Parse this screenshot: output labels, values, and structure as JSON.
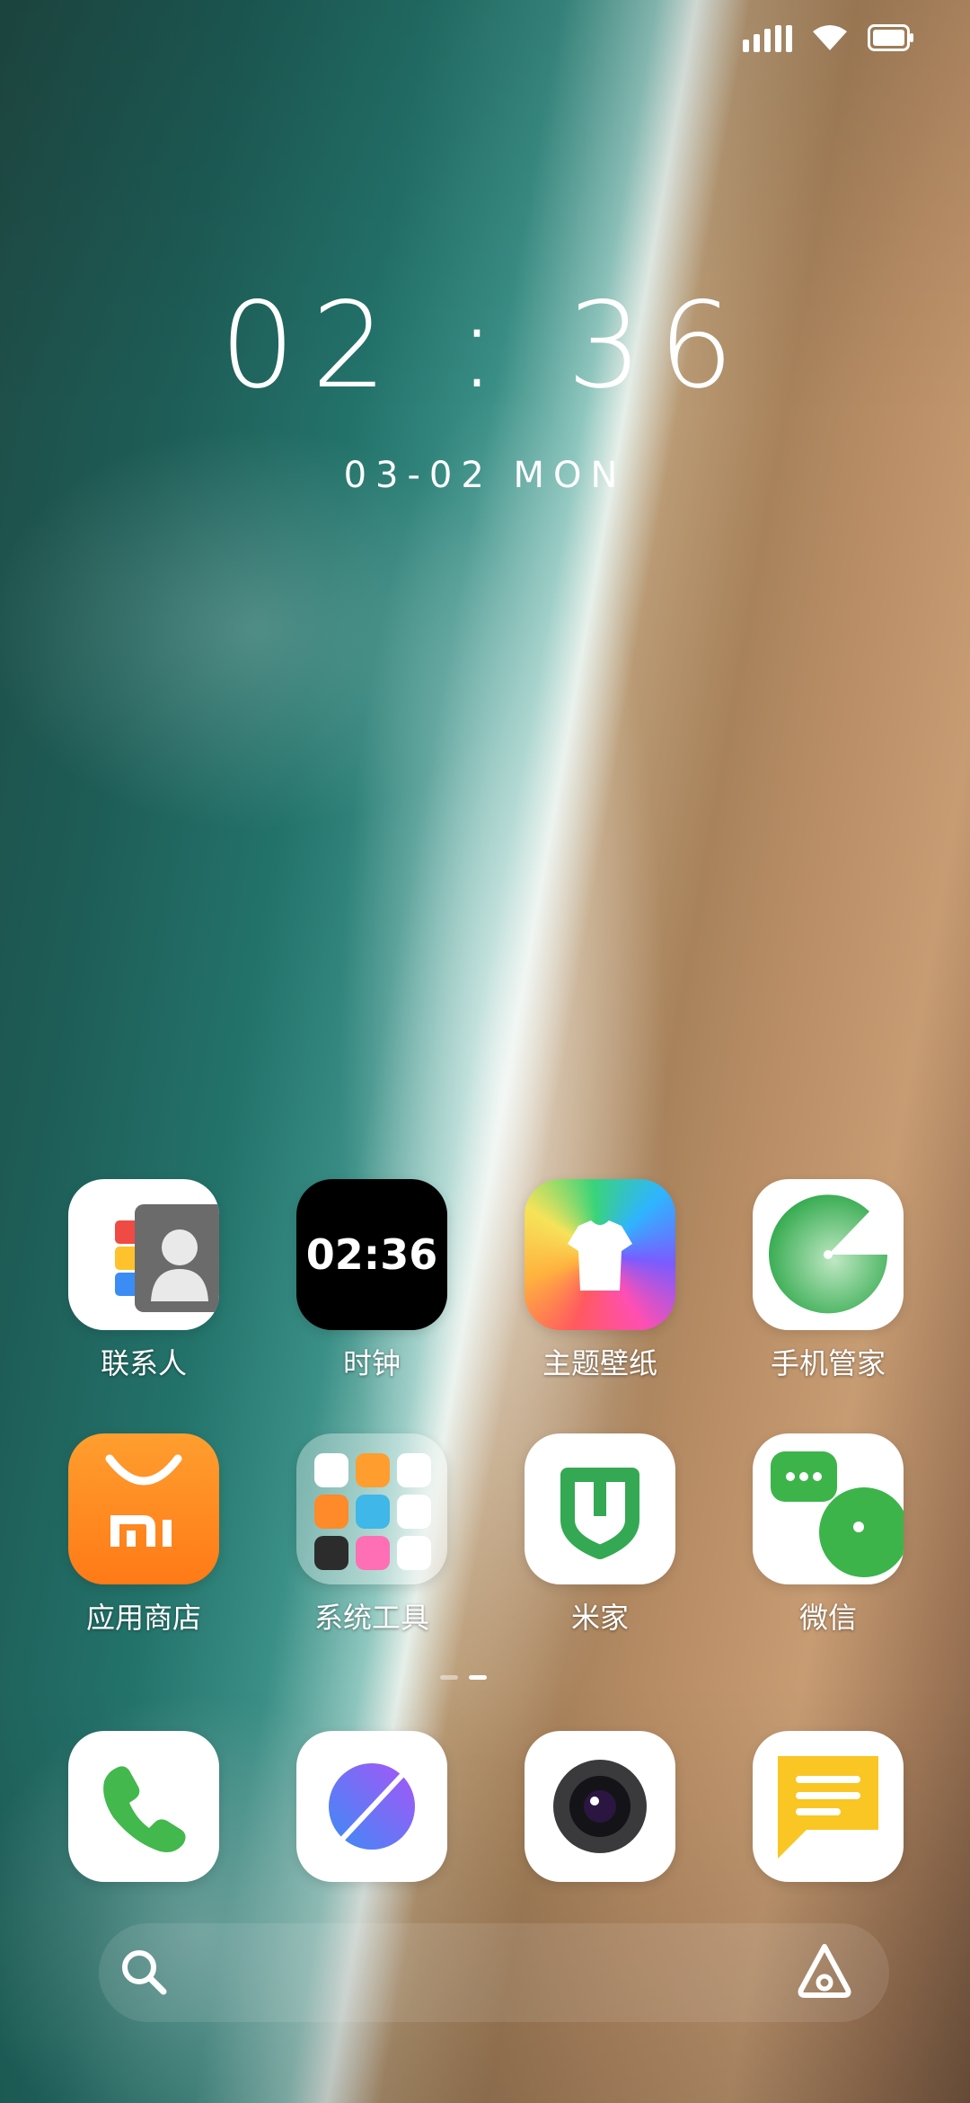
{
  "status_bar": {
    "icons": [
      "signal-icon",
      "wifi-icon",
      "battery-icon"
    ]
  },
  "clock": {
    "time": "02 : 36",
    "date": "03-02  MON"
  },
  "apps": [
    {
      "label": "联系人",
      "icon": "contacts-icon"
    },
    {
      "label": "时钟",
      "icon": "clock-app-icon",
      "tile_text": "02:36"
    },
    {
      "label": "主题壁纸",
      "icon": "themes-icon"
    },
    {
      "label": "手机管家",
      "icon": "security-icon"
    },
    {
      "label": "应用商店",
      "icon": "app-store-icon"
    },
    {
      "label": "系统工具",
      "icon": "folder-icon"
    },
    {
      "label": "米家",
      "icon": "mi-home-icon"
    },
    {
      "label": "微信",
      "icon": "wechat-icon"
    }
  ],
  "dock": [
    {
      "icon": "phone-icon"
    },
    {
      "icon": "browser-icon"
    },
    {
      "icon": "camera-icon"
    },
    {
      "icon": "messages-icon"
    }
  ],
  "page_indicator": {
    "pages": 2,
    "active": 1
  },
  "search_bar": {
    "icons": [
      "search-icon",
      "assistant-icon"
    ]
  },
  "colors": {
    "accent_green": "#3cb44a",
    "orange": "#ff8a1f",
    "message_yellow": "#f9c623"
  }
}
